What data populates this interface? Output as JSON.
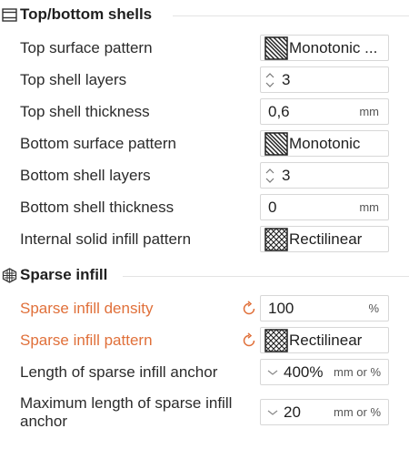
{
  "sections": {
    "top_bottom": {
      "title": "Top/bottom shells"
    },
    "sparse": {
      "title": "Sparse infill"
    }
  },
  "fields": {
    "top_surface_pattern": {
      "label": "Top surface pattern",
      "value": "Monotonic ..."
    },
    "top_shell_layers": {
      "label": "Top shell layers",
      "value": "3"
    },
    "top_shell_thickness": {
      "label": "Top shell thickness",
      "value": "0,6",
      "unit": "mm"
    },
    "bottom_surface_pattern": {
      "label": "Bottom surface pattern",
      "value": "Monotonic"
    },
    "bottom_shell_layers": {
      "label": "Bottom shell layers",
      "value": "3"
    },
    "bottom_shell_thickness": {
      "label": "Bottom shell thickness",
      "value": "0",
      "unit": "mm"
    },
    "internal_solid_infill_pattern": {
      "label": "Internal solid infill pattern",
      "value": "Rectilinear"
    },
    "sparse_infill_density": {
      "label": "Sparse infill density",
      "value": "100",
      "unit": "%"
    },
    "sparse_infill_pattern": {
      "label": "Sparse infill pattern",
      "value": "Rectilinear"
    },
    "sparse_infill_anchor": {
      "label": "Length of sparse infill anchor",
      "value": "400%",
      "unit": "mm or %"
    },
    "max_sparse_infill_anchor": {
      "label": "Maximum length of sparse infill anchor",
      "value": "20",
      "unit": "mm or %"
    }
  },
  "colors": {
    "modified_label": "#e0703a",
    "text": "#2b2b2b",
    "border": "#d7d7d7"
  },
  "icons": {
    "top_bottom_section": "shell-layers-icon",
    "sparse_section": "infill-hexagon-icon",
    "reset": "reset-arrow-icon"
  }
}
